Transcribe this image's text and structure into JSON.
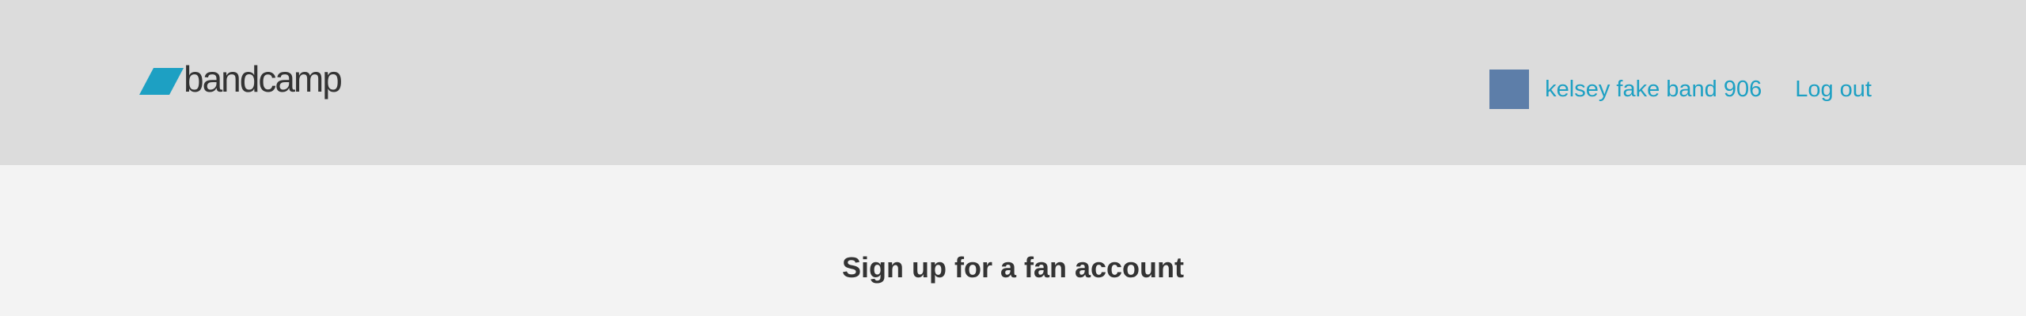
{
  "header": {
    "logo_text": "bandcamp",
    "user": {
      "name": "kelsey fake band 906"
    },
    "logout_label": "Log out"
  },
  "main": {
    "title": "Sign up for a fan account"
  },
  "colors": {
    "header_bg": "#dcdcdc",
    "page_bg": "#f3f3f3",
    "link": "#1da0c3",
    "logo_mark": "#1da0c3",
    "avatar": "#5d7ea9",
    "text": "#333333"
  },
  "icons": {
    "logo_mark": "bandcamp-parallelogram-icon"
  }
}
